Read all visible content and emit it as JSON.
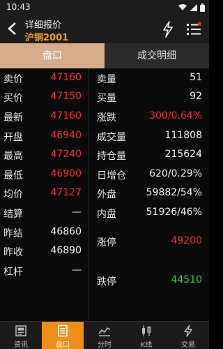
{
  "status_bar": {
    "time": "10:43"
  },
  "header": {
    "title": "详细报价",
    "subtitle": "沪铜2001"
  },
  "tabs": [
    {
      "label": "盘口",
      "active": true
    },
    {
      "label": "成交明细",
      "active": false
    }
  ],
  "left_rows": [
    {
      "label": "卖价",
      "value": "47160",
      "color": "red"
    },
    {
      "label": "买价",
      "value": "47150",
      "color": "red"
    },
    {
      "label": "最新",
      "value": "47160",
      "color": "red"
    },
    {
      "label": "开盘",
      "value": "46940",
      "color": "red"
    },
    {
      "label": "最高",
      "value": "47240",
      "color": "red"
    },
    {
      "label": "最低",
      "value": "46900",
      "color": "red"
    },
    {
      "label": "均价",
      "value": "47127",
      "color": "red"
    },
    {
      "label": "结算",
      "value": "—",
      "color": "white"
    },
    {
      "label": "昨结",
      "value": "46860",
      "color": "white"
    },
    {
      "label": "昨收",
      "value": "46890",
      "color": "white"
    },
    {
      "label": "杠杆",
      "value": "—",
      "color": "white"
    }
  ],
  "right_rows": [
    {
      "label": "卖量",
      "value": "51",
      "color": "white"
    },
    {
      "label": "买量",
      "value": "92",
      "color": "white"
    },
    {
      "label": "涨跌",
      "value": "300/0.64%",
      "color": "red"
    },
    {
      "label": "成交量",
      "value": "111808",
      "color": "white"
    },
    {
      "label": "持仓量",
      "value": "215624",
      "color": "white"
    },
    {
      "label": "日增仓",
      "value": "620/0.29%",
      "color": "white"
    },
    {
      "label": "外盘",
      "value": "59882/54%",
      "color": "white"
    },
    {
      "label": "内盘",
      "value": "51926/46%",
      "color": "white"
    },
    {
      "label": "涨停",
      "value": "49200",
      "color": "red"
    },
    {
      "label": "跌停",
      "value": "44510",
      "color": "green"
    }
  ],
  "nav": [
    {
      "label": "资讯",
      "icon": "news-icon",
      "active": false
    },
    {
      "label": "盘口",
      "icon": "quote-panel-icon",
      "active": true
    },
    {
      "label": "分时",
      "icon": "timeshare-chart-icon",
      "active": false
    },
    {
      "label": "K线",
      "icon": "candlestick-icon",
      "active": false
    },
    {
      "label": "交易",
      "icon": "trade-flash-icon",
      "active": false
    }
  ],
  "colors": {
    "red": "#ee2f2f",
    "green": "#2fd23a",
    "accent": "#ef8f17",
    "tab_active": "#d6ad8b",
    "subtitle": "#e9a31b"
  }
}
